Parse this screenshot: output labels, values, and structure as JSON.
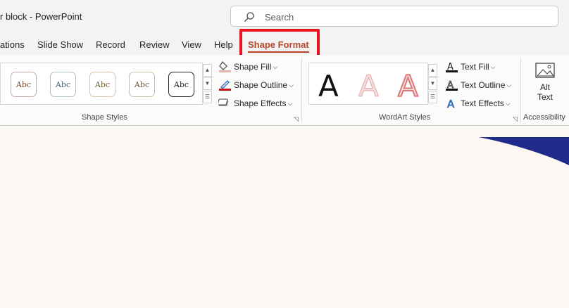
{
  "window": {
    "title": "r block  -  PowerPoint"
  },
  "search": {
    "placeholder": "Search"
  },
  "tabs": [
    {
      "label": "ations"
    },
    {
      "label": "Slide Show"
    },
    {
      "label": "Record"
    },
    {
      "label": "Review"
    },
    {
      "label": "View"
    },
    {
      "label": "Help"
    },
    {
      "label": "Shape Format",
      "active": true
    }
  ],
  "shape_styles": {
    "gallery": [
      "Abc",
      "Abc",
      "Abc",
      "Abc",
      "Abc"
    ],
    "fill_label": "Shape Fill",
    "outline_label": "Shape Outline",
    "effects_label": "Shape Effects",
    "group_label": "Shape Styles"
  },
  "wordart": {
    "gallery": [
      "A",
      "A",
      "A"
    ],
    "text_fill_label": "Text Fill",
    "text_outline_label": "Text Outline",
    "text_effects_label": "Text Effects",
    "group_label": "WordArt Styles"
  },
  "accessibility": {
    "alt_text_line1": "Alt",
    "alt_text_line2": "Text",
    "group_label": "Accessibility"
  },
  "colors": {
    "accent": "#b7472a",
    "highlight": "#e8131f",
    "slide_shape": "#1f2a8a"
  }
}
